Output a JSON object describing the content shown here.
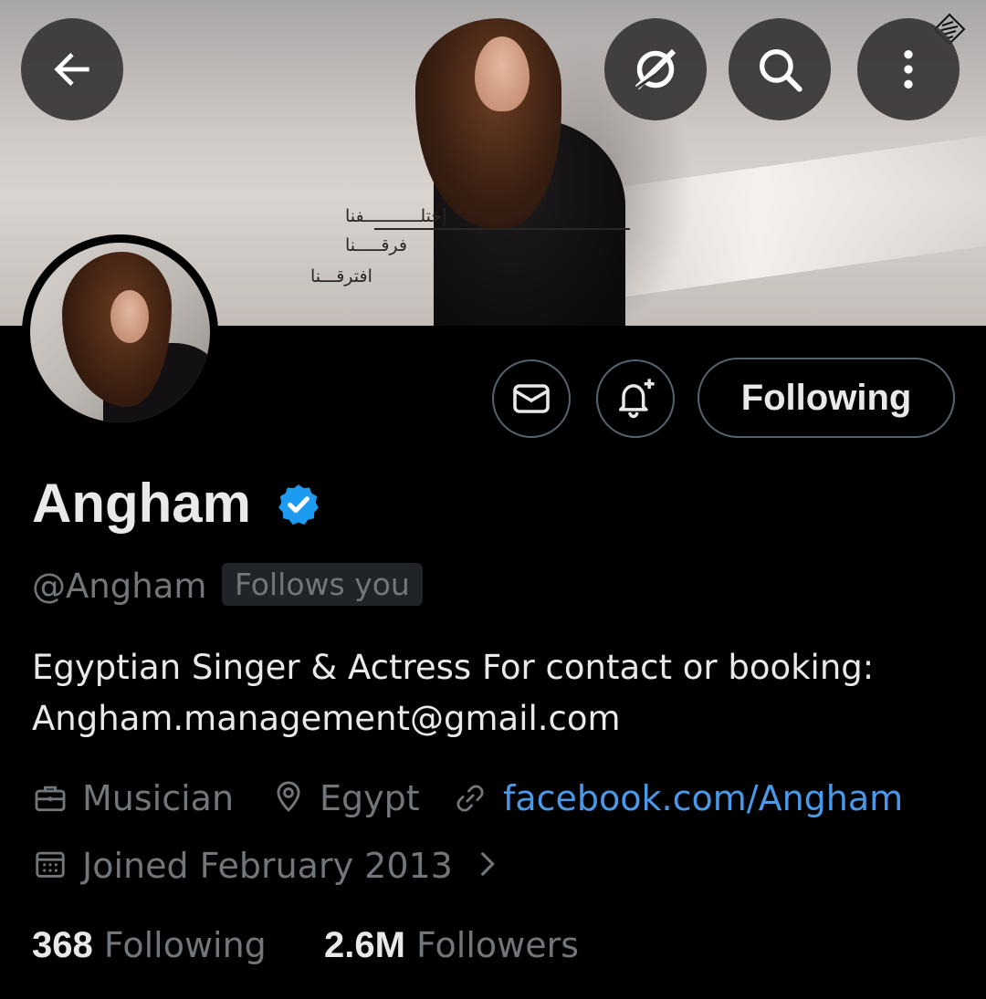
{
  "banner": {
    "arabic_lines": [
      "إختلـــــــــــفنا",
      "فرقـــــنا",
      "افترقـــنا"
    ]
  },
  "top_bar": {
    "back": "back-arrow-icon",
    "grok": "grok-icon",
    "search": "search-icon",
    "more": "more-vertical-icon"
  },
  "actions": {
    "message_icon": "envelope-icon",
    "notify_icon": "bell-plus-icon",
    "following_label": "Following"
  },
  "profile": {
    "name": "Angham",
    "verified": true,
    "handle": "@Angham",
    "follows_you": "Follows you",
    "bio_line1": "Egyptian Singer & Actress For contact or booking:",
    "bio_line2": "Angham.management@gmail.com",
    "category": "Musician",
    "location": "Egypt",
    "website": "facebook.com/Angham",
    "joined": "Joined February 2013"
  },
  "stats": {
    "following_count": "368",
    "following_label": "Following",
    "followers_count": "2.6M",
    "followers_label": "Followers"
  },
  "colors": {
    "background": "#000000",
    "text": "#e7e9ea",
    "muted": "#71767b",
    "link": "#4a99e9",
    "verified": "#1d9bf0",
    "border": "#536471"
  }
}
